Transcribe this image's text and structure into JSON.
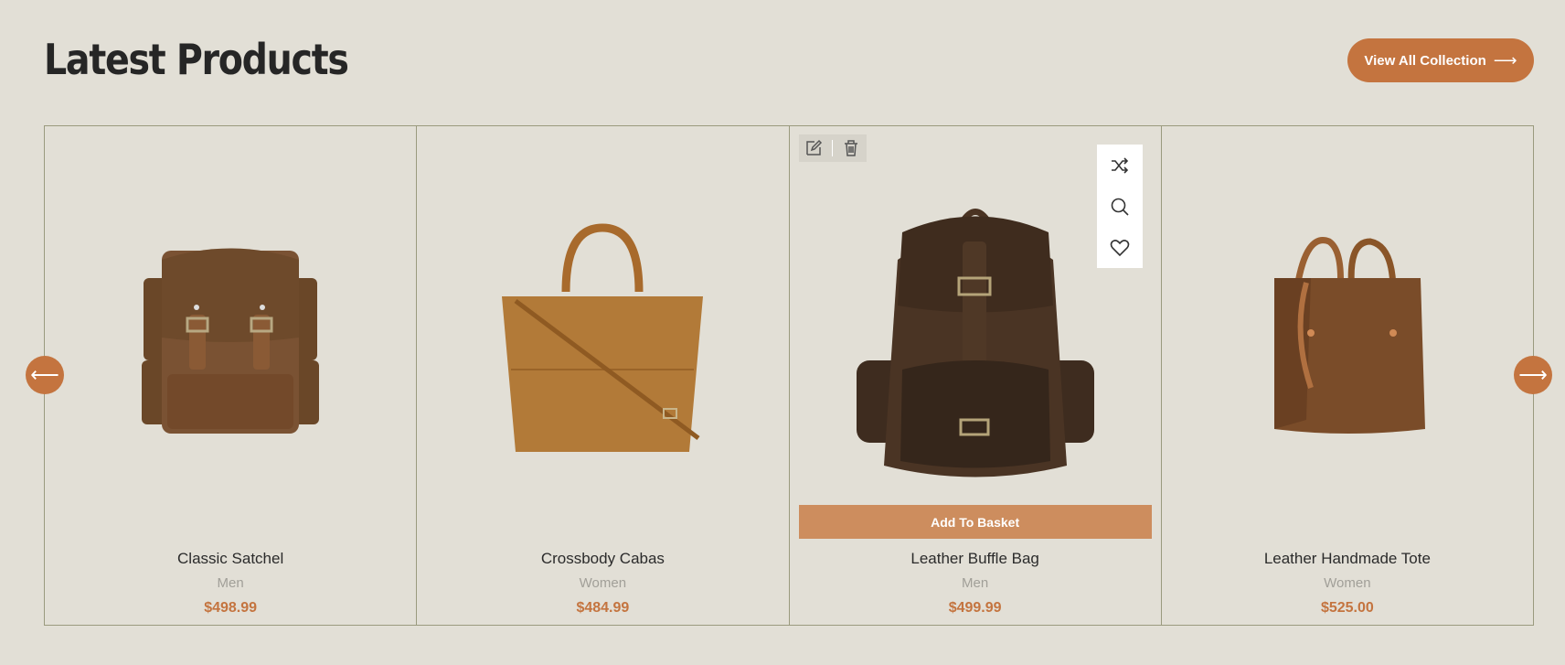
{
  "header": {
    "title": "Latest Products",
    "view_all_label": "View All Collection",
    "view_all_icon": "arrow-right-icon"
  },
  "carousel": {
    "prev_icon": "arrow-left-icon",
    "next_icon": "arrow-right-icon"
  },
  "products": [
    {
      "name": "Classic Satchel",
      "category": "Men",
      "price": "$498.99"
    },
    {
      "name": "Crossbody Cabas",
      "category": "Women",
      "price": "$484.99"
    },
    {
      "name": "Leather Buffle Bag",
      "category": "Men",
      "price": "$499.99",
      "basket_label": "Add To Basket"
    },
    {
      "name": "Leather Handmade Tote",
      "category": "Women",
      "price": "$525.00"
    }
  ],
  "hover_tools": [
    "shuffle-icon",
    "search-icon",
    "heart-icon"
  ],
  "edit_tools": [
    "edit-icon",
    "trash-icon"
  ],
  "colors": {
    "accent": "#c4743f",
    "basket": "#cd8d5e",
    "background": "#e2dfd6",
    "muted": "#a19f98"
  }
}
